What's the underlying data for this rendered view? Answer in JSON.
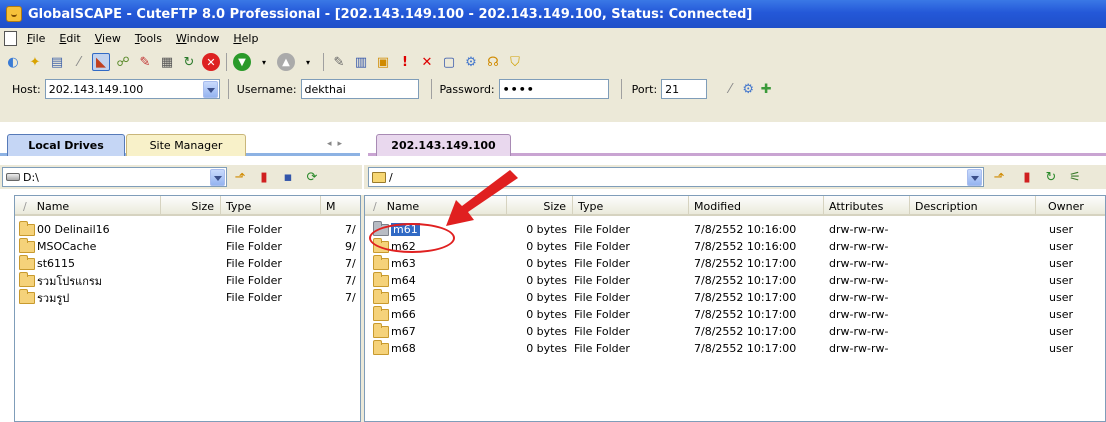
{
  "window": {
    "title": "GlobalSCAPE - CuteFTP 8.0 Professional - [202.143.149.100 - 202.143.149.100, Status: Connected]"
  },
  "menu": [
    "File",
    "Edit",
    "View",
    "Tools",
    "Window",
    "Help"
  ],
  "quickconnect": {
    "host_label": "Host:",
    "host_value": "202.143.149.100",
    "username_label": "Username:",
    "username_value": "dekthai",
    "password_label": "Password:",
    "password_value": "••••",
    "port_label": "Port:",
    "port_value": "21"
  },
  "tabs": {
    "local_drives": "Local Drives",
    "site_manager": "Site Manager",
    "remote": "202.143.149.100"
  },
  "local": {
    "path": "D:\\",
    "columns": [
      "Name",
      "Size",
      "Type",
      "M"
    ],
    "rows": [
      {
        "name": "00 Delinail16",
        "type": "File Folder",
        "m": "7/"
      },
      {
        "name": "MSOCache",
        "type": "File Folder",
        "m": "9/"
      },
      {
        "name": "st6115",
        "type": "File Folder",
        "m": "7/"
      },
      {
        "name": "รวมโปรแกรม",
        "type": "File Folder",
        "m": "7/"
      },
      {
        "name": "รวมรูป",
        "type": "File Folder",
        "m": "7/"
      }
    ]
  },
  "remote": {
    "path": "/",
    "columns": [
      "Name",
      "Size",
      "Type",
      "Modified",
      "Attributes",
      "Description",
      "Owner"
    ],
    "rows": [
      {
        "name": "m61",
        "size": "0 bytes",
        "type": "File Folder",
        "modified": "7/8/2552 10:16:00",
        "attributes": "drw-rw-rw-",
        "owner": "user"
      },
      {
        "name": "m62",
        "size": "0 bytes",
        "type": "File Folder",
        "modified": "7/8/2552 10:16:00",
        "attributes": "drw-rw-rw-",
        "owner": "user"
      },
      {
        "name": "m63",
        "size": "0 bytes",
        "type": "File Folder",
        "modified": "7/8/2552 10:17:00",
        "attributes": "drw-rw-rw-",
        "owner": "user"
      },
      {
        "name": "m64",
        "size": "0 bytes",
        "type": "File Folder",
        "modified": "7/8/2552 10:17:00",
        "attributes": "drw-rw-rw-",
        "owner": "user"
      },
      {
        "name": "m65",
        "size": "0 bytes",
        "type": "File Folder",
        "modified": "7/8/2552 10:17:00",
        "attributes": "drw-rw-rw-",
        "owner": "user"
      },
      {
        "name": "m66",
        "size": "0 bytes",
        "type": "File Folder",
        "modified": "7/8/2552 10:17:00",
        "attributes": "drw-rw-rw-",
        "owner": "user"
      },
      {
        "name": "m67",
        "size": "0 bytes",
        "type": "File Folder",
        "modified": "7/8/2552 10:17:00",
        "attributes": "drw-rw-rw-",
        "owner": "user"
      },
      {
        "name": "m68",
        "size": "0 bytes",
        "type": "File Folder",
        "modified": "7/8/2552 10:17:00",
        "attributes": "drw-rw-rw-",
        "owner": "user"
      }
    ]
  },
  "colors": {
    "accent": "#316ac5",
    "annotation": "#e02020"
  }
}
